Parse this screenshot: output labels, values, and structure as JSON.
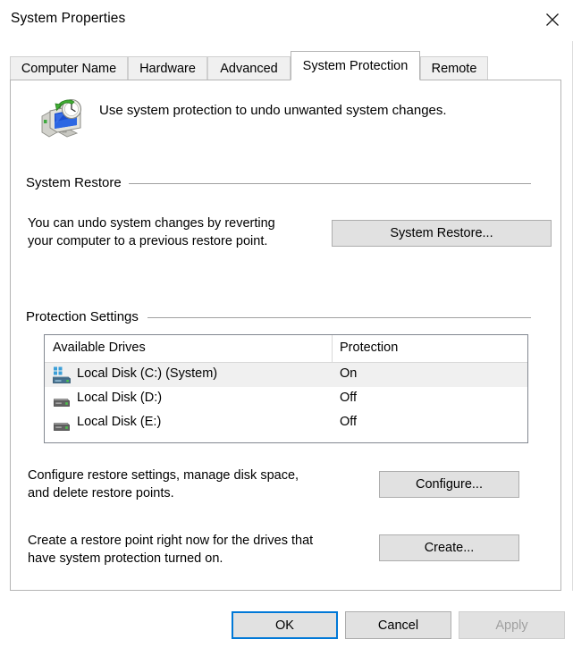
{
  "window": {
    "title": "System Properties",
    "close_label": "Close",
    "close_icon": "close-icon"
  },
  "tabs": [
    {
      "label": "Computer Name",
      "active": false
    },
    {
      "label": "Hardware",
      "active": false
    },
    {
      "label": "Advanced",
      "active": false
    },
    {
      "label": "System Protection",
      "active": true
    },
    {
      "label": "Remote",
      "active": false
    }
  ],
  "header": {
    "icon": "system-restore-icon",
    "text": "Use system protection to undo unwanted system changes."
  },
  "system_restore": {
    "group_label": "System Restore",
    "description_line1": "You can undo system changes by reverting",
    "description_line2": "your computer to a previous restore point.",
    "button_label": "System Restore..."
  },
  "protection_settings": {
    "group_label": "Protection Settings",
    "columns": [
      "Available Drives",
      "Protection"
    ],
    "rows": [
      {
        "icon": "system-drive-icon",
        "drive": "Local Disk (C:) (System)",
        "protection": "On",
        "selected": true
      },
      {
        "icon": "drive-icon",
        "drive": "Local Disk (D:)",
        "protection": "Off",
        "selected": false
      },
      {
        "icon": "drive-icon",
        "drive": "Local Disk (E:)",
        "protection": "Off",
        "selected": false
      }
    ],
    "configure_line1": "Configure restore settings, manage disk space,",
    "configure_line2": "and delete restore points.",
    "configure_button": "Configure...",
    "create_line1": "Create a restore point right now for the drives that",
    "create_line2": "have system protection turned on.",
    "create_button": "Create..."
  },
  "footer": {
    "ok_label": "OK",
    "cancel_label": "Cancel",
    "apply_label": "Apply",
    "apply_disabled": true
  },
  "colors": {
    "accent": "#0078d7",
    "button_face": "#e1e1e1",
    "button_border": "#adadad",
    "selection": "#f0f0f0",
    "group_line": "#a0a0a0"
  }
}
